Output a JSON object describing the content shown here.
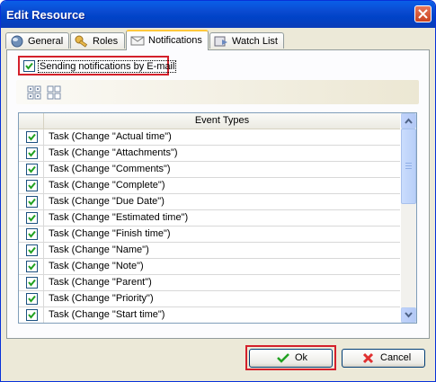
{
  "window": {
    "title": "Edit Resource"
  },
  "tabs": [
    {
      "label": "General",
      "icon": "globe-icon",
      "active": false
    },
    {
      "label": "Roles",
      "icon": "key-icon",
      "active": false
    },
    {
      "label": "Notifications",
      "icon": "envelope-icon",
      "active": true
    },
    {
      "label": "Watch List",
      "icon": "watch-list-icon",
      "active": false
    }
  ],
  "notifications": {
    "email_label": "Sending notifications by E-mail",
    "email_checked": true,
    "toolbar": [
      {
        "icon": "check-all-icon"
      },
      {
        "icon": "uncheck-all-icon"
      }
    ],
    "grid": {
      "header": "Event Types",
      "rows": [
        {
          "label": "Task (Change \"Actual time\")",
          "checked": true
        },
        {
          "label": "Task (Change \"Attachments\")",
          "checked": true
        },
        {
          "label": "Task (Change \"Comments\")",
          "checked": true
        },
        {
          "label": "Task (Change \"Complete\")",
          "checked": true
        },
        {
          "label": "Task (Change \"Due Date\")",
          "checked": true
        },
        {
          "label": "Task (Change \"Estimated time\")",
          "checked": true
        },
        {
          "label": "Task (Change \"Finish time\")",
          "checked": true
        },
        {
          "label": "Task (Change \"Name\")",
          "checked": true
        },
        {
          "label": "Task (Change \"Note\")",
          "checked": true
        },
        {
          "label": "Task (Change \"Parent\")",
          "checked": true
        },
        {
          "label": "Task (Change \"Priority\")",
          "checked": true
        },
        {
          "label": "Task (Change \"Start time\")",
          "checked": true
        }
      ]
    }
  },
  "buttons": {
    "ok_label": "Ok",
    "cancel_label": "Cancel"
  },
  "colors": {
    "titlebar": "#0a4ad0",
    "highlight": "#d4202b",
    "check": "#21a121",
    "cancel_icon": "#e03030"
  }
}
